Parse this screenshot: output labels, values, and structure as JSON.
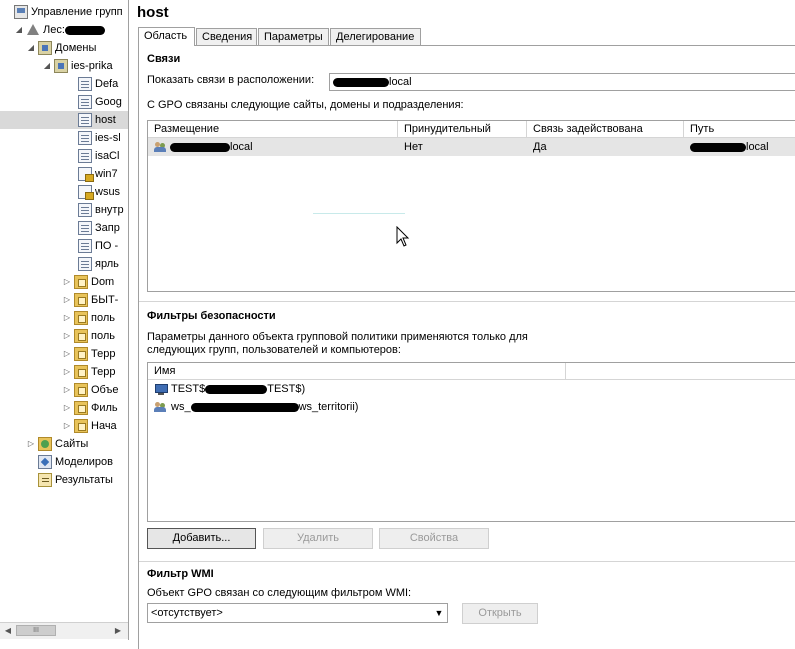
{
  "tree": {
    "items": [
      {
        "label": "Управление групп",
        "icon": "console-icon",
        "expander": "",
        "redact_w": 0
      },
      {
        "label": "Лес:",
        "icon": "forest-icon",
        "expander": "◢",
        "redact_w": 40
      },
      {
        "label": "Домены",
        "icon": "domains-icon",
        "expander": "◢",
        "redact_w": 0
      },
      {
        "label": "ies-prika",
        "icon": "domain-icon",
        "expander": "◢",
        "redact_w": 0
      },
      {
        "label": "Defa",
        "icon": "gpo-icon",
        "expander": "",
        "redact_w": 0
      },
      {
        "label": "Goog",
        "icon": "gpo-icon",
        "expander": "",
        "redact_w": 0
      },
      {
        "label": "host",
        "icon": "gpo-icon",
        "expander": "",
        "redact_w": 0
      },
      {
        "label": "ies-sl",
        "icon": "gpo-icon",
        "expander": "",
        "redact_w": 0
      },
      {
        "label": "isaCl",
        "icon": "gpo-icon",
        "expander": "",
        "redact_w": 0
      },
      {
        "label": "win7",
        "icon": "gpo-lock-icon",
        "expander": "",
        "redact_w": 0
      },
      {
        "label": "wsus",
        "icon": "gpo-lock-icon",
        "expander": "",
        "redact_w": 0
      },
      {
        "label": "внутр",
        "icon": "gpo-icon",
        "expander": "",
        "redact_w": 0
      },
      {
        "label": "Запр",
        "icon": "gpo-icon",
        "expander": "",
        "redact_w": 0
      },
      {
        "label": "ПО -",
        "icon": "gpo-icon",
        "expander": "",
        "redact_w": 0
      },
      {
        "label": "ярль",
        "icon": "gpo-icon",
        "expander": "",
        "redact_w": 0
      },
      {
        "label": "Dom",
        "icon": "ou-icon",
        "expander": "▷",
        "redact_w": 0
      },
      {
        "label": "БЫТ-",
        "icon": "ou-icon",
        "expander": "▷",
        "redact_w": 0
      },
      {
        "label": "поль",
        "icon": "ou-icon",
        "expander": "▷",
        "redact_w": 0
      },
      {
        "label": "поль",
        "icon": "ou-icon",
        "expander": "▷",
        "redact_w": 0
      },
      {
        "label": "Терр",
        "icon": "ou-icon",
        "expander": "▷",
        "redact_w": 0
      },
      {
        "label": "Терр",
        "icon": "ou-icon",
        "expander": "▷",
        "redact_w": 0
      },
      {
        "label": "Объе",
        "icon": "ou-icon",
        "expander": "▷",
        "redact_w": 0
      },
      {
        "label": "Филь",
        "icon": "ou-icon",
        "expander": "▷",
        "redact_w": 0
      },
      {
        "label": "Нача",
        "icon": "ou-icon",
        "expander": "▷",
        "redact_w": 0
      },
      {
        "label": "Сайты",
        "icon": "sites-icon",
        "expander": "▷",
        "redact_w": 0
      },
      {
        "label": "Моделиров",
        "icon": "modeling-icon",
        "expander": "",
        "redact_w": 0
      },
      {
        "label": "Результаты",
        "icon": "results-icon",
        "expander": "",
        "redact_w": 0
      }
    ],
    "scroll_thumb": "III"
  },
  "header": {
    "title": "host"
  },
  "tabs": [
    {
      "label": "Область",
      "active": true
    },
    {
      "label": "Сведения",
      "active": false
    },
    {
      "label": "Параметры",
      "active": false
    },
    {
      "label": "Делегирование",
      "active": false
    }
  ],
  "links": {
    "title": "Связи",
    "location_label": "Показать связи в расположении:",
    "location_value": "local",
    "description": "С GPO связаны следующие сайты, домены и подразделения:",
    "columns": [
      "Размещение",
      "Принудительный",
      "Связь задействована",
      "Путь"
    ],
    "rows": [
      {
        "location": "local",
        "enforced": "Нет",
        "enabled": "Да",
        "path": "local"
      }
    ]
  },
  "security": {
    "title": "Фильтры безопасности",
    "description_line1": "Параметры данного объекта групповой политики применяются только для",
    "description_line2": "следующих групп, пользователей и компьютеров:",
    "column_name": "Имя",
    "rows": [
      {
        "prefix": "TEST$",
        "suffix": "TEST$)",
        "icon": "computer-icon"
      },
      {
        "prefix": "ws_",
        "suffix": "ws_territorii)",
        "icon": "group-icon"
      }
    ],
    "buttons": {
      "add": "Добавить...",
      "remove": "Удалить",
      "properties": "Свойства"
    }
  },
  "wmi": {
    "title": "Фильтр WMI",
    "description": "Объект GPO связан со следующим фильтром WMI:",
    "selected": "<отсутствует>",
    "open_button": "Открыть"
  }
}
